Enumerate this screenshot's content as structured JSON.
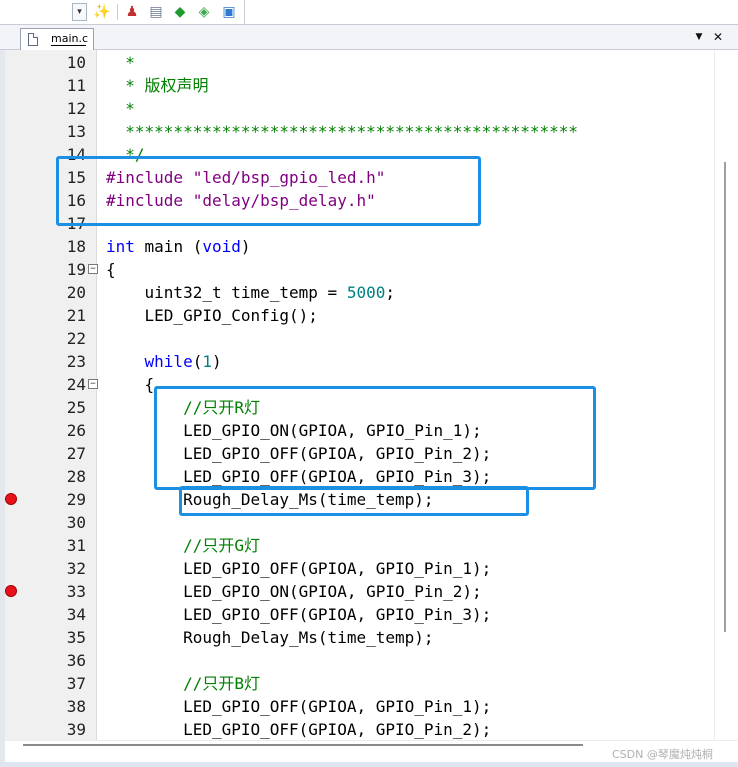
{
  "toolbar": {
    "icons": [
      "dropdown-arrow-icon",
      "magic-wand-icon",
      "build-target-icon",
      "windows-stack-icon",
      "diamond-debug-icon",
      "diamond-settings-icon",
      "translate-icon"
    ]
  },
  "tabs": [
    {
      "label": "main.c",
      "active": true
    }
  ],
  "editor": {
    "lines": [
      {
        "num": "10",
        "text": "  *",
        "type": "comment"
      },
      {
        "num": "11",
        "text": "  * 版权声明",
        "type": "comment"
      },
      {
        "num": "12",
        "text": "  *",
        "type": "comment"
      },
      {
        "num": "13",
        "text": "  ***********************************************",
        "type": "comment"
      },
      {
        "num": "14",
        "text": "  */",
        "type": "comment"
      },
      {
        "num": "15",
        "pre": "#include ",
        "str": "\"led/bsp_gpio_led.h\"",
        "type": "include"
      },
      {
        "num": "16",
        "pre": "#include ",
        "str": "\"delay/bsp_delay.h\"",
        "type": "include"
      },
      {
        "num": "17",
        "text": "",
        "type": "plain"
      },
      {
        "num": "18",
        "kw": "int",
        "mid": " main (",
        "kw2": "void",
        "end": ")",
        "type": "funcdef"
      },
      {
        "num": "19",
        "text": "{",
        "type": "plain",
        "fold": true
      },
      {
        "num": "20",
        "pre_plain": "    uint32_t time_temp = ",
        "num_val": "5000",
        "post": ";",
        "type": "numline"
      },
      {
        "num": "21",
        "text": "    LED_GPIO_Config();",
        "type": "plain"
      },
      {
        "num": "22",
        "text": "",
        "type": "plain"
      },
      {
        "num": "23",
        "lead": "    ",
        "kw": "while",
        "open": "(",
        "num_val": "1",
        "close": ")",
        "type": "while"
      },
      {
        "num": "24",
        "text": "    {",
        "type": "plain",
        "fold": true
      },
      {
        "num": "25",
        "text": "        //只开R灯",
        "type": "comment"
      },
      {
        "num": "26",
        "text": "        LED_GPIO_ON(GPIOA, GPIO_Pin_1);",
        "type": "plain"
      },
      {
        "num": "27",
        "text": "        LED_GPIO_OFF(GPIOA, GPIO_Pin_2);",
        "type": "plain"
      },
      {
        "num": "28",
        "text": "        LED_GPIO_OFF(GPIOA, GPIO_Pin_3);",
        "type": "plain"
      },
      {
        "num": "29",
        "text": "        Rough_Delay_Ms(time_temp);",
        "type": "plain",
        "breakpoint": true
      },
      {
        "num": "30",
        "text": "",
        "type": "plain"
      },
      {
        "num": "31",
        "text": "        //只开G灯",
        "type": "comment"
      },
      {
        "num": "32",
        "text": "        LED_GPIO_OFF(GPIOA, GPIO_Pin_1);",
        "type": "plain"
      },
      {
        "num": "33",
        "text": "        LED_GPIO_ON(GPIOA, GPIO_Pin_2);",
        "type": "plain",
        "breakpoint": true
      },
      {
        "num": "34",
        "text": "        LED_GPIO_OFF(GPIOA, GPIO_Pin_3);",
        "type": "plain"
      },
      {
        "num": "35",
        "text": "        Rough_Delay_Ms(time_temp);",
        "type": "plain"
      },
      {
        "num": "36",
        "text": "",
        "type": "plain"
      },
      {
        "num": "37",
        "text": "        //只开B灯",
        "type": "comment"
      },
      {
        "num": "38",
        "text": "        LED_GPIO_OFF(GPIOA, GPIO_Pin_1);",
        "type": "plain"
      },
      {
        "num": "39",
        "text": "        LED_GPIO_OFF(GPIOA, GPIO_Pin_2);",
        "type": "plain"
      }
    ]
  },
  "colors": {
    "comment": "#008000",
    "preprocessor": "#800080",
    "keyword": "#0000ff",
    "number": "#008080",
    "highlight_box": "#1a8fe3",
    "breakpoint": "#e8121d"
  },
  "watermark": "CSDN @琴魔炖炖桐"
}
